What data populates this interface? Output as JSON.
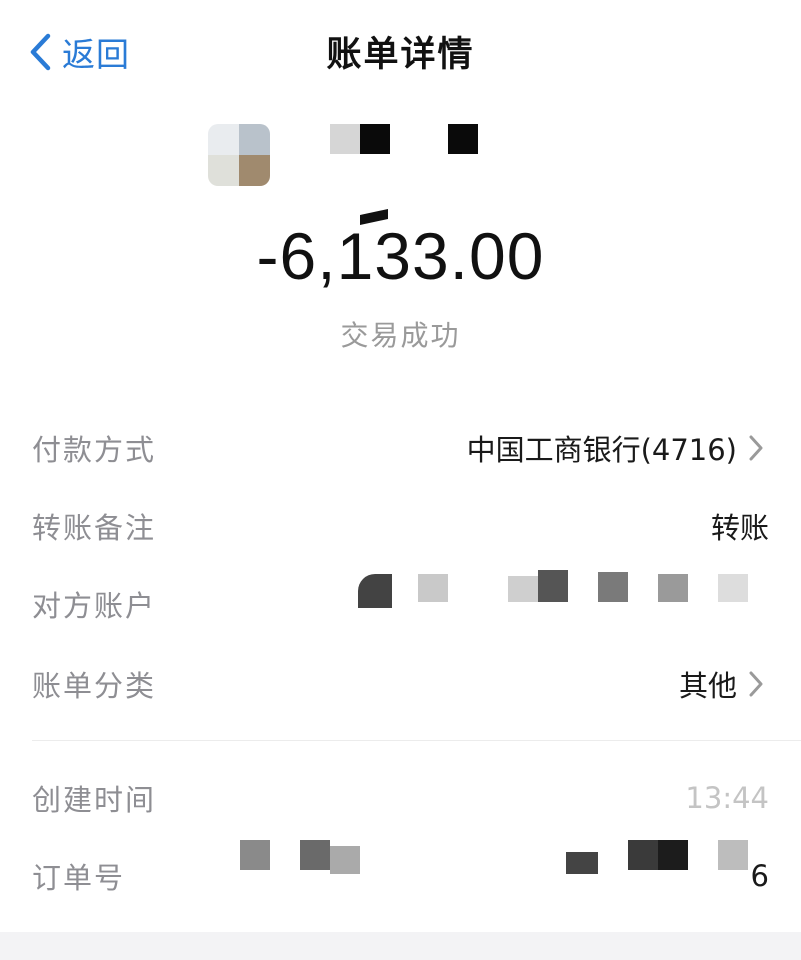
{
  "nav": {
    "back_label": "返回",
    "title": "账单详情"
  },
  "transaction": {
    "amount": "-6,133.00",
    "status": "交易成功"
  },
  "details": [
    {
      "label": "付款方式",
      "value": "中国工商银行(4716)",
      "has_chevron": true
    },
    {
      "label": "转账备注",
      "value": "转账",
      "has_chevron": false
    },
    {
      "label": "对方账户",
      "value": "",
      "masked": true
    },
    {
      "label": "账单分类",
      "value": "其他",
      "has_chevron": true
    }
  ],
  "meta": [
    {
      "label": "创建时间",
      "value_visible_fragment": "13:44",
      "masked": true
    },
    {
      "label": "订单号",
      "value_visible_fragment": "6",
      "masked": true
    }
  ],
  "icons": {
    "back": "chevron-left-icon",
    "row_arrow": "chevron-right-icon"
  },
  "colors": {
    "accent": "#2a7bd6",
    "label_gray": "#8e8e93",
    "status_gray": "#9a9a9a"
  }
}
